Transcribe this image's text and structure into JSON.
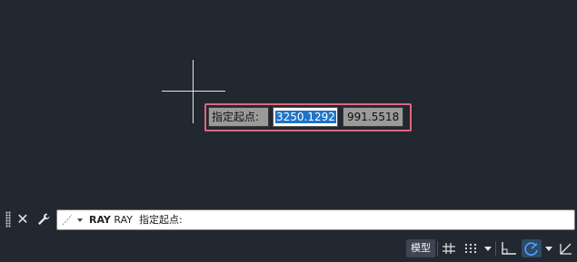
{
  "dynamic_input": {
    "prompt": "指定起点:",
    "x_value": "3250.1292",
    "y_value": "991.5518"
  },
  "command_line": {
    "command_name": "RAY",
    "history_text": "RAY  指定起点:",
    "close_icon": "close-icon",
    "settings_icon": "wrench-icon",
    "recent_icon": "recent-commands-icon"
  },
  "status_bar": {
    "model_label": "模型",
    "icons": [
      "grid-icon",
      "snap-icon",
      "dropdown-icon",
      "ortho-icon",
      "polar-icon",
      "dropdown-icon",
      "isodraft-icon"
    ]
  },
  "colors": {
    "background": "#212830",
    "highlight_frame": "#e0667e",
    "selection": "#1e74c8",
    "polar_active": "#4aa3ff"
  }
}
